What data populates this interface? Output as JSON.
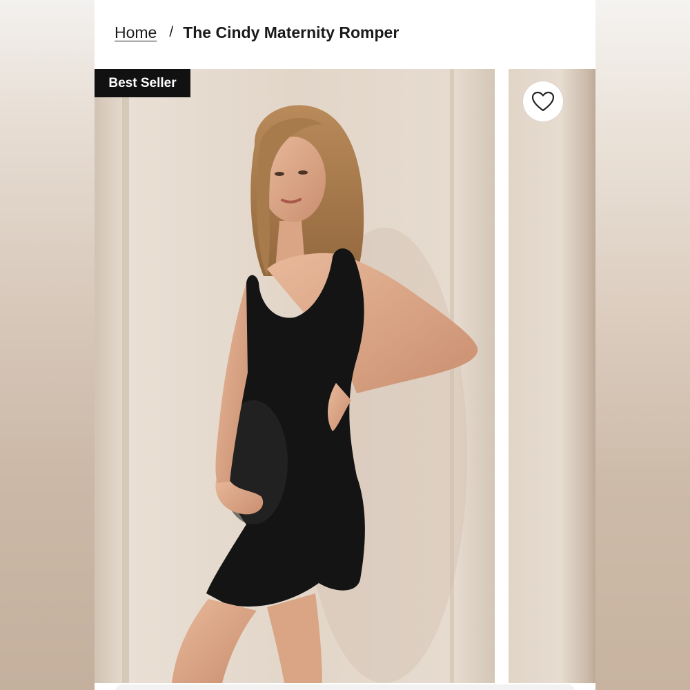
{
  "breadcrumb": {
    "home_label": "Home",
    "separator": "/",
    "current_label": "The Cindy Maternity Romper"
  },
  "product": {
    "badge_label": "Best Seller",
    "colors": {
      "badge_bg": "#111111",
      "garment": "#141414",
      "backdrop": "#e3d7ca"
    }
  },
  "icons": {
    "wishlist": "heart-outline-icon"
  }
}
